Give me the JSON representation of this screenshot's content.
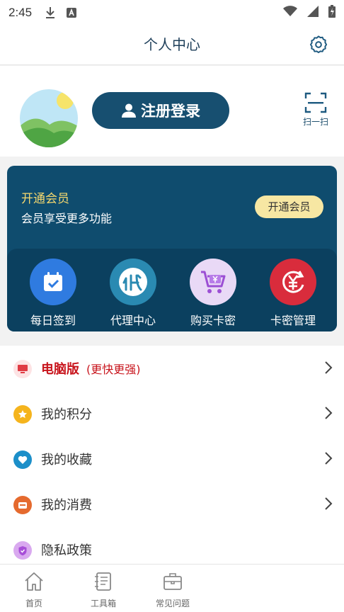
{
  "status_bar": {
    "time": "2:45"
  },
  "header": {
    "title": "个人中心"
  },
  "profile": {
    "login_label": "注册登录",
    "scan_label": "扫一扫"
  },
  "vip": {
    "title": "开通会员",
    "subtitle": "会员享受更多功能",
    "button_label": "开通会员",
    "features": [
      {
        "label": "每日签到",
        "icon": "calendar-check-icon",
        "color": "#2f7be0"
      },
      {
        "label": "代理中心",
        "icon": "agent-icon",
        "color": "#2a8ab2"
      },
      {
        "label": "购买卡密",
        "icon": "shopping-cart-icon",
        "color": "#e9d9f6"
      },
      {
        "label": "卡密管理",
        "icon": "currency-exchange-icon",
        "color": "#d92c3c"
      }
    ]
  },
  "menu": {
    "items": [
      {
        "label": "电脑版",
        "extra": "(更快更强)",
        "icon": "monitor-icon"
      },
      {
        "label": "我的积分",
        "icon": "star-coin-icon"
      },
      {
        "label": "我的收藏",
        "icon": "heart-icon"
      },
      {
        "label": "我的消费",
        "icon": "wallet-icon"
      },
      {
        "label": "隐私政策",
        "icon": "shield-icon"
      }
    ]
  },
  "tabbar": {
    "tabs": [
      {
        "label": "首页",
        "icon": "home-icon"
      },
      {
        "label": "工具箱",
        "icon": "notebook-icon"
      },
      {
        "label": "常见问题",
        "icon": "briefcase-icon"
      }
    ]
  },
  "colors": {
    "primary": "#174f70",
    "accent_gold": "#f5d86e",
    "hot_red": "#c8151d"
  }
}
